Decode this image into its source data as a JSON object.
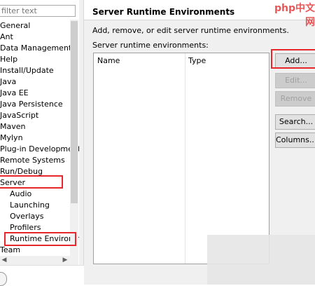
{
  "filter": {
    "placeholder": "filter text"
  },
  "tree": [
    {
      "label": "General",
      "level": 0
    },
    {
      "label": "Ant",
      "level": 0
    },
    {
      "label": "Data Management",
      "level": 0
    },
    {
      "label": "Help",
      "level": 0
    },
    {
      "label": "Install/Update",
      "level": 0
    },
    {
      "label": "Java",
      "level": 0
    },
    {
      "label": "Java EE",
      "level": 0
    },
    {
      "label": "Java Persistence",
      "level": 0
    },
    {
      "label": "JavaScript",
      "level": 0
    },
    {
      "label": "Maven",
      "level": 0
    },
    {
      "label": "Mylyn",
      "level": 0
    },
    {
      "label": "Plug-in Development",
      "level": 0
    },
    {
      "label": "Remote Systems",
      "level": 0
    },
    {
      "label": "Run/Debug",
      "level": 0
    },
    {
      "label": "Server",
      "level": 0,
      "highlighted": true
    },
    {
      "label": "Audio",
      "level": 1
    },
    {
      "label": "Launching",
      "level": 1
    },
    {
      "label": "Overlays",
      "level": 1
    },
    {
      "label": "Profilers",
      "level": 1
    },
    {
      "label": "Runtime Environm",
      "level": 1,
      "highlighted": true,
      "selected": true
    },
    {
      "label": "Team",
      "level": 0
    }
  ],
  "page": {
    "title": "Server Runtime Environments",
    "description": "Add, remove, or edit server runtime environments.",
    "list_label": "Server runtime environments:"
  },
  "table": {
    "columns": [
      "Name",
      "Type"
    ],
    "rows": []
  },
  "buttons": {
    "add": "Add...",
    "edit": "Edit...",
    "remove": "Remove",
    "search": "Search...",
    "columns": "Columns..."
  },
  "watermark": "php中文网",
  "highlight_color": "#e8262b"
}
